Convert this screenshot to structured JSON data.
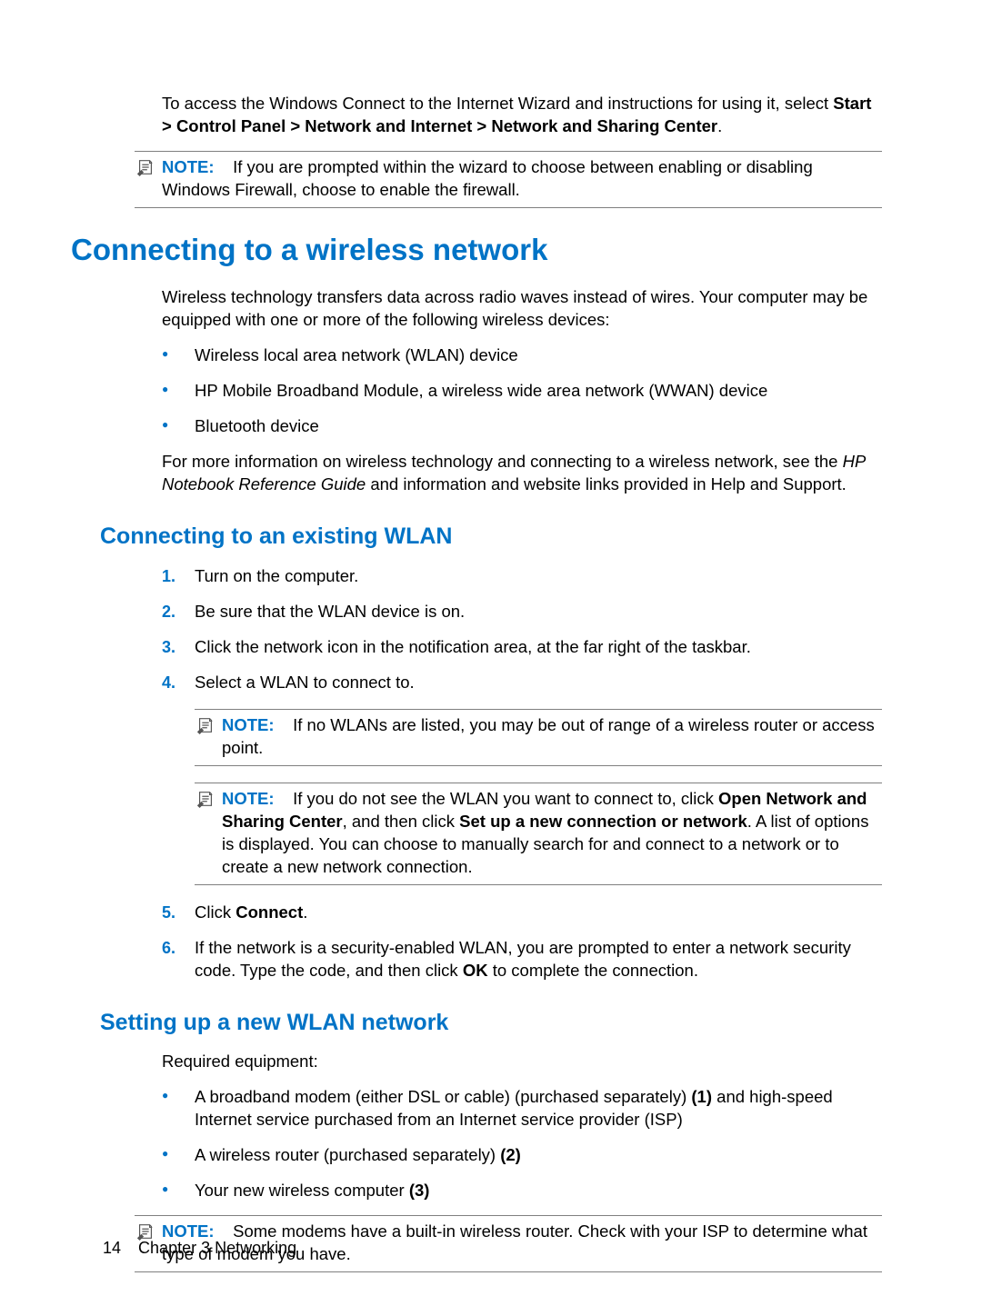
{
  "intro": {
    "p1a": "To access the Windows Connect to the Internet Wizard and instructions for using it, select ",
    "p1b": "Start > Control Panel > Network and Internet > Network and Sharing Center",
    "p1c": "."
  },
  "note_label": "NOTE:",
  "note1": "If you are prompted within the wizard to choose between enabling or disabling Windows Firewall, choose to enable the firewall.",
  "h1": "Connecting to a wireless network",
  "wireless_intro": "Wireless technology transfers data across radio waves instead of wires. Your computer may be equipped with one or more of the following wireless devices:",
  "devices": [
    "Wireless local area network (WLAN) device",
    "HP Mobile Broadband Module, a wireless wide area network (WWAN) device",
    "Bluetooth device"
  ],
  "more_info_a": "For more information on wireless technology and connecting to a wireless network, see the ",
  "more_info_b": "HP Notebook Reference Guide",
  "more_info_c": " and information and website links provided in Help and Support.",
  "h2a": "Connecting to an existing WLAN",
  "steps": [
    "Turn on the computer.",
    "Be sure that the WLAN device is on.",
    "Click the network icon in the notification area, at the far right of the taskbar.",
    "Select a WLAN to connect to."
  ],
  "note_wlan1": "If no WLANs are listed, you may be out of range of a wireless router or access point.",
  "note_wlan2_a": "If you do not see the WLAN you want to connect to, click ",
  "note_wlan2_b": "Open Network and Sharing Center",
  "note_wlan2_c": ", and then click ",
  "note_wlan2_d": "Set up a new connection or network",
  "note_wlan2_e": ". A list of options is displayed. You can choose to manually search for and connect to a network or to create a new network connection.",
  "step5a": "Click ",
  "step5b": "Connect",
  "step5c": ".",
  "step6a": "If the network is a security-enabled WLAN, you are prompted to enter a network security code. Type the code, and then click ",
  "step6b": "OK",
  "step6c": " to complete the connection.",
  "h2b": "Setting up a new WLAN network",
  "req": "Required equipment:",
  "equip1a": "A broadband modem (either DSL or cable) (purchased separately) ",
  "equip1b": "(1)",
  "equip1c": " and high-speed Internet service purchased from an Internet service provider (ISP)",
  "equip2a": "A wireless router (purchased separately) ",
  "equip2b": "(2)",
  "equip3a": "Your new wireless computer ",
  "equip3b": "(3)",
  "note_modem": "Some modems have a built-in wireless router. Check with your ISP to determine what type of modem you have.",
  "footer": {
    "page": "14",
    "chapter": "Chapter 3   Networking"
  }
}
